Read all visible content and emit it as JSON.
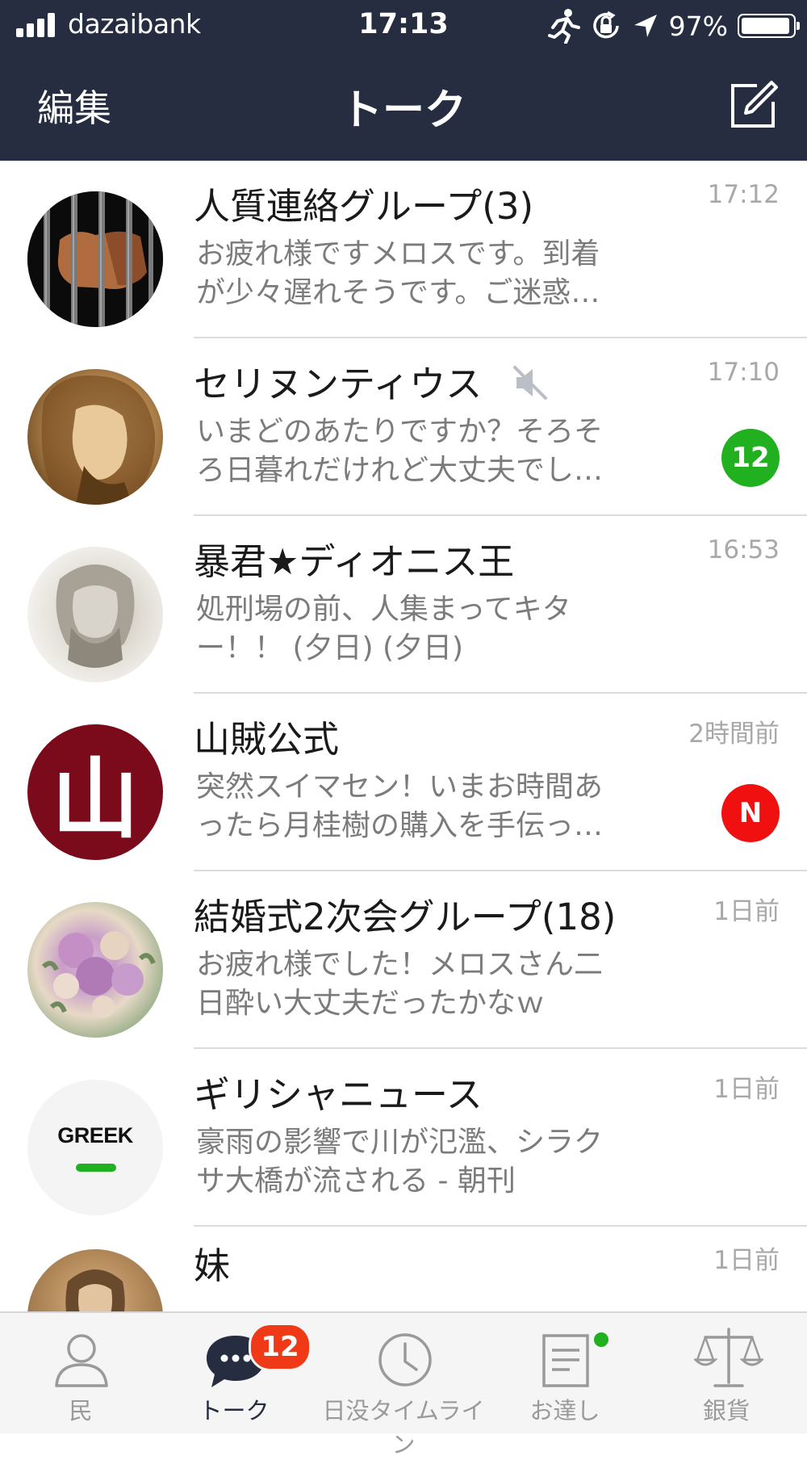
{
  "status_bar": {
    "carrier": "dazaibank",
    "time": "17:13",
    "battery": "97%",
    "icons": [
      "signal-icon",
      "running-icon",
      "rotation-lock-icon",
      "location-arrow-icon",
      "battery-icon"
    ]
  },
  "nav": {
    "edit_label": "編集",
    "title": "トーク",
    "compose_icon": "compose-icon"
  },
  "chats": [
    {
      "name": "人質連絡グループ(3)",
      "time": "17:12",
      "preview": "お疲れ様ですメロスです。到着が少々遅れそうです。ご迷惑…",
      "avatar": "prison-bars-image"
    },
    {
      "name": "セリヌンティウス",
      "time": "17:10",
      "preview": "いまどのあたりですか？そろそろ日暮れだけれど大丈夫でし…",
      "muted": true,
      "unread": "12",
      "avatar": "portrait-image"
    },
    {
      "name": "暴君★ディオニス王",
      "time": "16:53",
      "preview": "処刑場の前、人集まってキター！！ (夕日) (夕日)",
      "avatar": "statue-image"
    },
    {
      "name": "山賊公式",
      "time": "2時間前",
      "preview": "突然スイマセン！いまお時間あったら月桂樹の購入を手伝っ…",
      "avatar_text": "山",
      "new_badge": "N"
    },
    {
      "name": "結婚式2次会グループ(18)",
      "time": "1日前",
      "preview": "お疲れ様でした！メロスさん二日酔い大丈夫だったかなｗ",
      "avatar": "bouquet-image"
    },
    {
      "name": "ギリシャニュース",
      "time": "1日前",
      "preview": "豪雨の影響で川が氾濫、シラクサ大橋が流される - 朝刊",
      "avatar_text": "GREEK"
    },
    {
      "name": "妹",
      "time": "1日前",
      "preview": "",
      "avatar": "painting-image"
    }
  ],
  "tabs": [
    {
      "label": "民",
      "icon": "person-icon"
    },
    {
      "label": "トーク",
      "icon": "chat-bubble-icon",
      "badge": "12",
      "active": true
    },
    {
      "label": "日没タイムライン",
      "icon": "clock-icon"
    },
    {
      "label": "お達し",
      "icon": "notice-icon",
      "dot": true
    },
    {
      "label": "銀貨",
      "icon": "scales-icon"
    }
  ],
  "colors": {
    "header_bg": "#262d40",
    "unread_badge": "#20b020",
    "new_badge": "#f01010",
    "tab_badge": "#f03a17"
  }
}
